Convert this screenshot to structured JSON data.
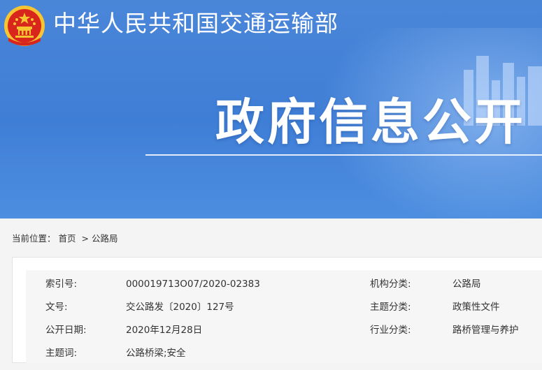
{
  "header": {
    "ministry_name": "中华人民共和国交通运输部",
    "section_title": "政府信息公开"
  },
  "breadcrumb": {
    "label": "当前位置：",
    "items": [
      "首页",
      "公路局"
    ],
    "separator": ">"
  },
  "info": {
    "rows": [
      {
        "label1": "索引号:",
        "value1": "000019713O07/2020-02383",
        "label2": "机构分类:",
        "value2": "公路局"
      },
      {
        "label1": "文号:",
        "value1": "交公路发〔2020〕127号",
        "label2": "主题分类:",
        "value2": "政策性文件"
      },
      {
        "label1": "公开日期:",
        "value1": "2020年12月28日",
        "label2": "行业分类:",
        "value2": "路桥管理与养护"
      },
      {
        "label1": "主题词:",
        "value1": "公路桥梁;安全",
        "label2": "",
        "value2": ""
      }
    ]
  },
  "colors": {
    "banner": "#4a86d8",
    "emblem_red": "#d9261c",
    "emblem_gold": "#f6c531"
  },
  "icons": {
    "emblem": "national-emblem-icon",
    "skyline": "city-skyline-icon"
  }
}
